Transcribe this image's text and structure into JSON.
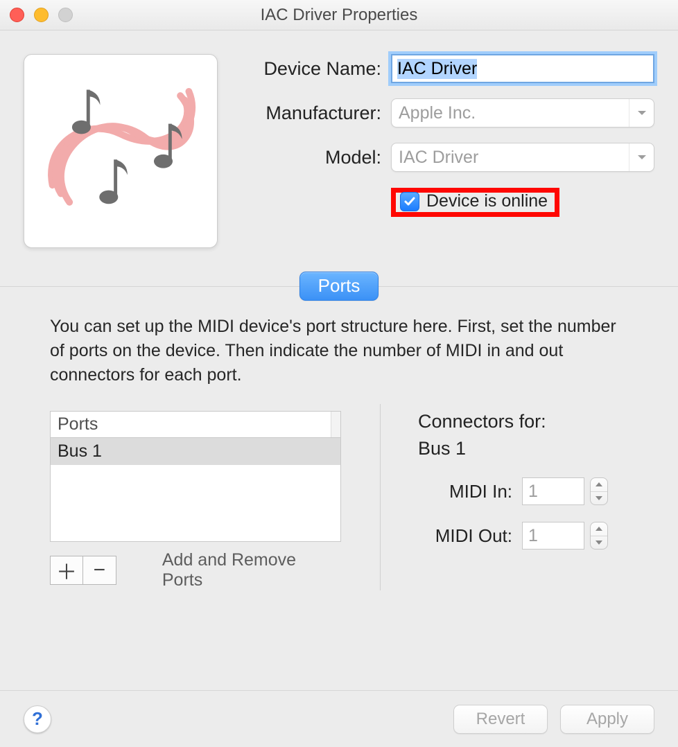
{
  "window": {
    "title": "IAC Driver Properties"
  },
  "form": {
    "device_name_label": "Device Name:",
    "device_name_value": "IAC Driver",
    "manufacturer_label": "Manufacturer:",
    "manufacturer_value": "Apple Inc.",
    "model_label": "Model:",
    "model_value": "IAC Driver",
    "online_label": "Device is online",
    "online_checked": true
  },
  "tab": {
    "ports_label": "Ports"
  },
  "ports": {
    "help_text": "You can set up the MIDI device's port structure here. First, set the number of ports on the device. Then indicate the number of MIDI in and out connectors for each port.",
    "list_header": "Ports",
    "items": [
      "Bus 1"
    ],
    "add_remove_label": "Add and Remove Ports",
    "connectors_title": "Connectors for:",
    "connectors_for": "Bus 1",
    "midi_in_label": "MIDI In:",
    "midi_in_value": "1",
    "midi_out_label": "MIDI Out:",
    "midi_out_value": "1"
  },
  "footer": {
    "help_glyph": "?",
    "revert_label": "Revert",
    "apply_label": "Apply"
  }
}
